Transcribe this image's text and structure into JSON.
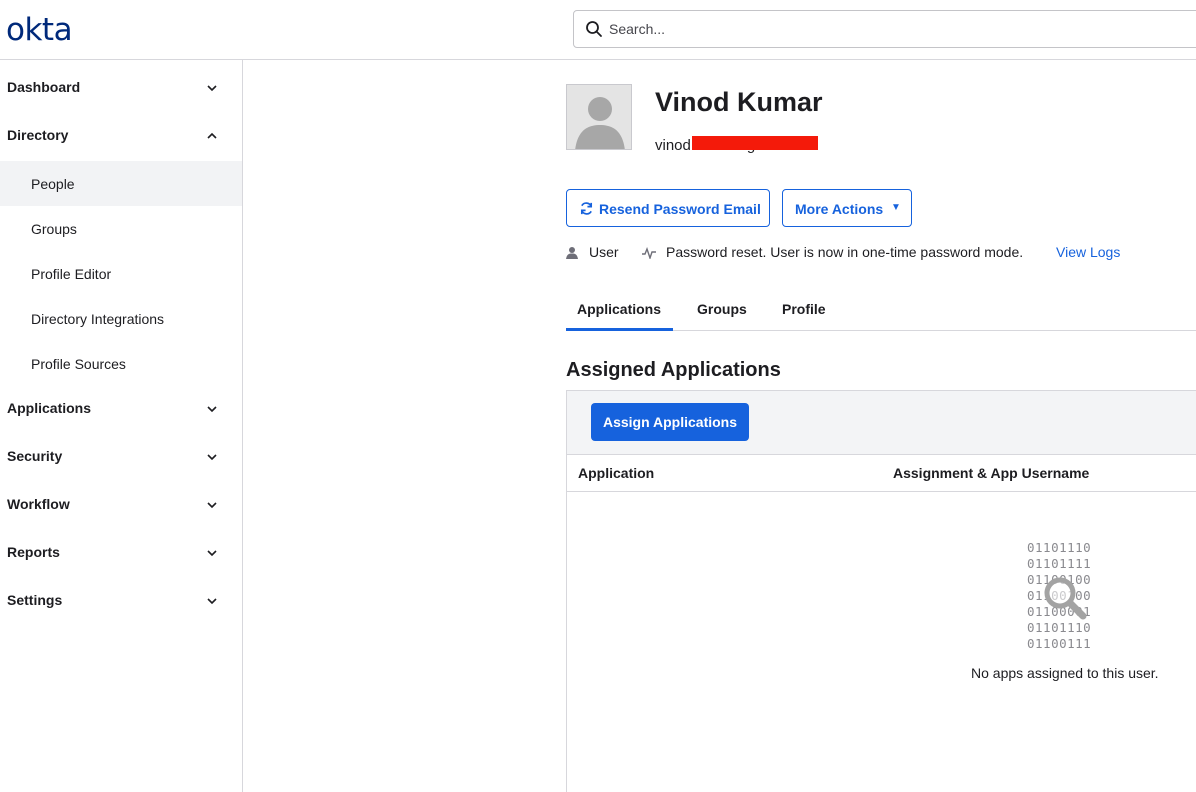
{
  "header": {
    "logo": "okta",
    "search": {
      "placeholder": "Search...",
      "value": ""
    }
  },
  "sidebar": {
    "sections": [
      {
        "label": "Dashboard",
        "expanded": false
      },
      {
        "label": "Directory",
        "expanded": true,
        "items": [
          {
            "label": "People",
            "active": true
          },
          {
            "label": "Groups"
          },
          {
            "label": "Profile Editor"
          },
          {
            "label": "Directory Integrations"
          },
          {
            "label": "Profile Sources"
          }
        ]
      },
      {
        "label": "Applications",
        "expanded": false
      },
      {
        "label": "Security",
        "expanded": false
      },
      {
        "label": "Workflow",
        "expanded": false
      },
      {
        "label": "Reports",
        "expanded": false
      },
      {
        "label": "Settings",
        "expanded": false
      }
    ]
  },
  "user": {
    "name": "Vinod Kumar",
    "email_visible": "vinod",
    "email_tail": "g",
    "type": "User",
    "status": "Password reset. User is now in one-time password mode.",
    "view_logs": "View Logs"
  },
  "actions": {
    "resend": "Resend Password Email",
    "more": "More Actions",
    "more_caret": "▼"
  },
  "tabs": [
    {
      "label": "Applications",
      "active": true
    },
    {
      "label": "Groups"
    },
    {
      "label": "Profile"
    }
  ],
  "assigned": {
    "title": "Assigned Applications",
    "assign_button": "Assign Applications",
    "columns": [
      "Application",
      "Assignment & App Username"
    ],
    "rows": [],
    "empty_binary": "01101110\n01101111\n01100100\n01100100\n01100001\n01101110\n01100111",
    "empty_message": "No apps assigned to this user."
  },
  "colors": {
    "brand": "#00297a",
    "accent": "#1662dd",
    "redaction": "#f41a0a"
  },
  "icons": [
    "search-icon",
    "chevron-down-icon",
    "chevron-up-icon",
    "avatar-placeholder-icon",
    "refresh-icon",
    "caret-down-icon",
    "user-icon",
    "pulse-icon",
    "magnifier-icon"
  ]
}
